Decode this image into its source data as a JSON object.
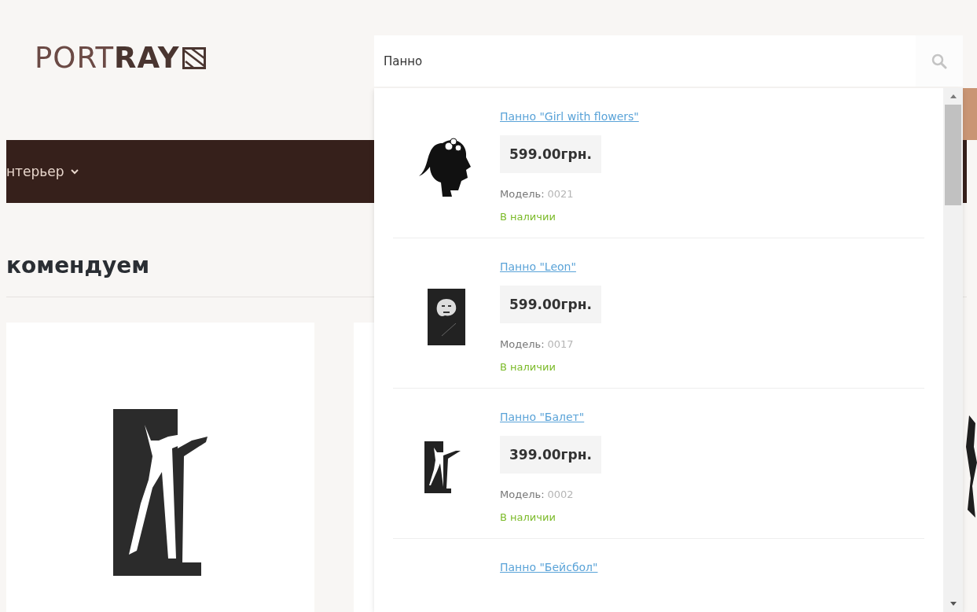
{
  "header": {
    "logo": "PORT**RAY**"
  },
  "search": {
    "value": "Панно"
  },
  "nav": {
    "items": [
      {
        "label": "нтерьер"
      }
    ]
  },
  "section": {
    "title": "комендуем"
  },
  "results": [
    {
      "kind": "full",
      "title": "Панно \"Girl with flowers\"",
      "price": "599.00грн.",
      "model_label": "Модель:",
      "model": "0021",
      "stock": "В наличии"
    },
    {
      "kind": "full",
      "title": "Панно \"Leon\"",
      "price": "599.00грн.",
      "model_label": "Модель:",
      "model": "0017",
      "stock": "В наличии"
    },
    {
      "kind": "full",
      "title": "Панно \"Балет\"",
      "price": "399.00грн.",
      "model_label": "Модель:",
      "model": "0002",
      "stock": "В наличии"
    },
    {
      "kind": "title_only",
      "title": "Панно \"Бейсбол\""
    }
  ]
}
